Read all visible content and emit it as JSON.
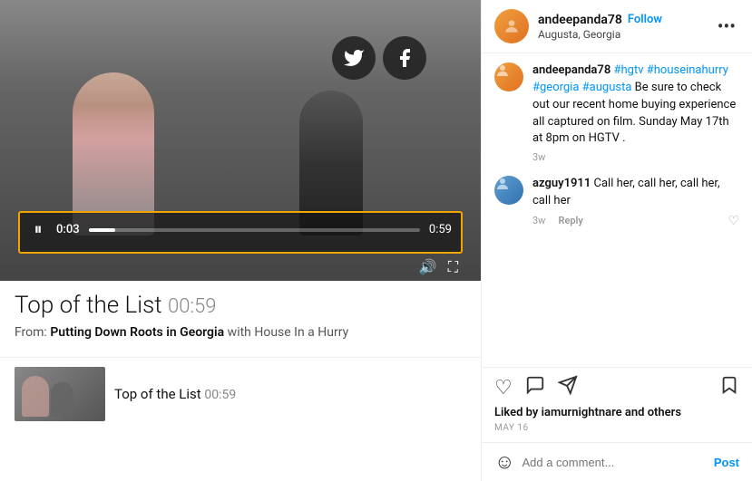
{
  "left": {
    "video": {
      "time_current": "0:03",
      "time_total": "0:59",
      "progress_percent": 8,
      "social_icons": [
        "twitter",
        "facebook"
      ]
    },
    "title": "Top of the List",
    "title_duration": "00:59",
    "from_label": "From:",
    "show_name": "Putting Down Roots in Georgia",
    "show_suffix": " with House In a Hurry",
    "thumbnail_title": "Top of the List",
    "thumbnail_duration": "00:59"
  },
  "right": {
    "header": {
      "username": "andeepanda78",
      "follow_label": "Follow",
      "location": "Augusta, Georgia",
      "more_icon": "•••"
    },
    "comments": [
      {
        "username": "andeepanda78",
        "text_parts": [
          "#hgtv #houseinahurry #georgia #augusta",
          " Be sure to check out our recent home buying experience all captured on film. Sunday May 17th at 8pm on HGTV ."
        ],
        "hashtags": true,
        "time": "3w",
        "show_reply": false
      },
      {
        "username": "azguy1911",
        "text": " Call her, call her, call her, call her",
        "time": "3w",
        "reply_label": "Reply",
        "show_reply": true
      }
    ],
    "actions": {
      "like_icon": "♡",
      "comment_icon": "💬",
      "share_icon": "➤",
      "bookmark_icon": "🔖"
    },
    "liked_by": {
      "label": "Liked by",
      "user": "iamurnightnare",
      "suffix": " and others"
    },
    "post_date": "MAY 16",
    "comment_input": {
      "placeholder": "Add a comment...",
      "post_label": "Post"
    }
  }
}
